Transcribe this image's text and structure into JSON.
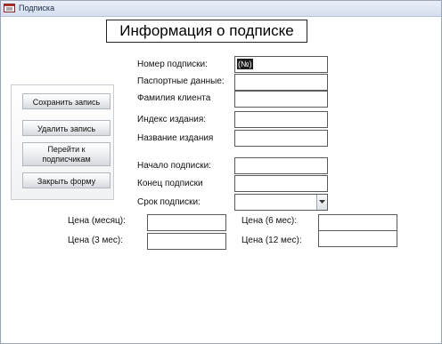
{
  "window": {
    "title": "Подписка"
  },
  "heading": "Информация о подписке",
  "buttons": {
    "save": "Сохранить запись",
    "delete": "Удалить запись",
    "goto_line1": "Перейти к",
    "goto_line2": "подписчикам",
    "close": "Закрыть форму"
  },
  "fields": {
    "subscription_number": {
      "label": "Номер подписки:",
      "value": "(№)"
    },
    "passport": {
      "label": "Паспортные данные:",
      "value": ""
    },
    "surname": {
      "label": "Фамилия клиента",
      "value": ""
    },
    "edition_index": {
      "label": "Индекс издания:",
      "value": ""
    },
    "edition_name": {
      "label": "Название издания",
      "value": ""
    },
    "start": {
      "label": "Начало подписки:",
      "value": ""
    },
    "end": {
      "label": "Конец  подписки",
      "value": ""
    },
    "term": {
      "label": "Срок подписки:",
      "value": ""
    }
  },
  "prices": {
    "month": {
      "label": "Цена (месяц):",
      "value": ""
    },
    "three": {
      "label": "Цена (3 мес):",
      "value": ""
    },
    "six": {
      "label": "Цена (6 мес):",
      "value": ""
    },
    "twelve": {
      "label": "Цена (12 мес):",
      "value": ""
    }
  },
  "icons": {
    "title": "form-icon",
    "dropdown": "chevron-down-icon"
  }
}
